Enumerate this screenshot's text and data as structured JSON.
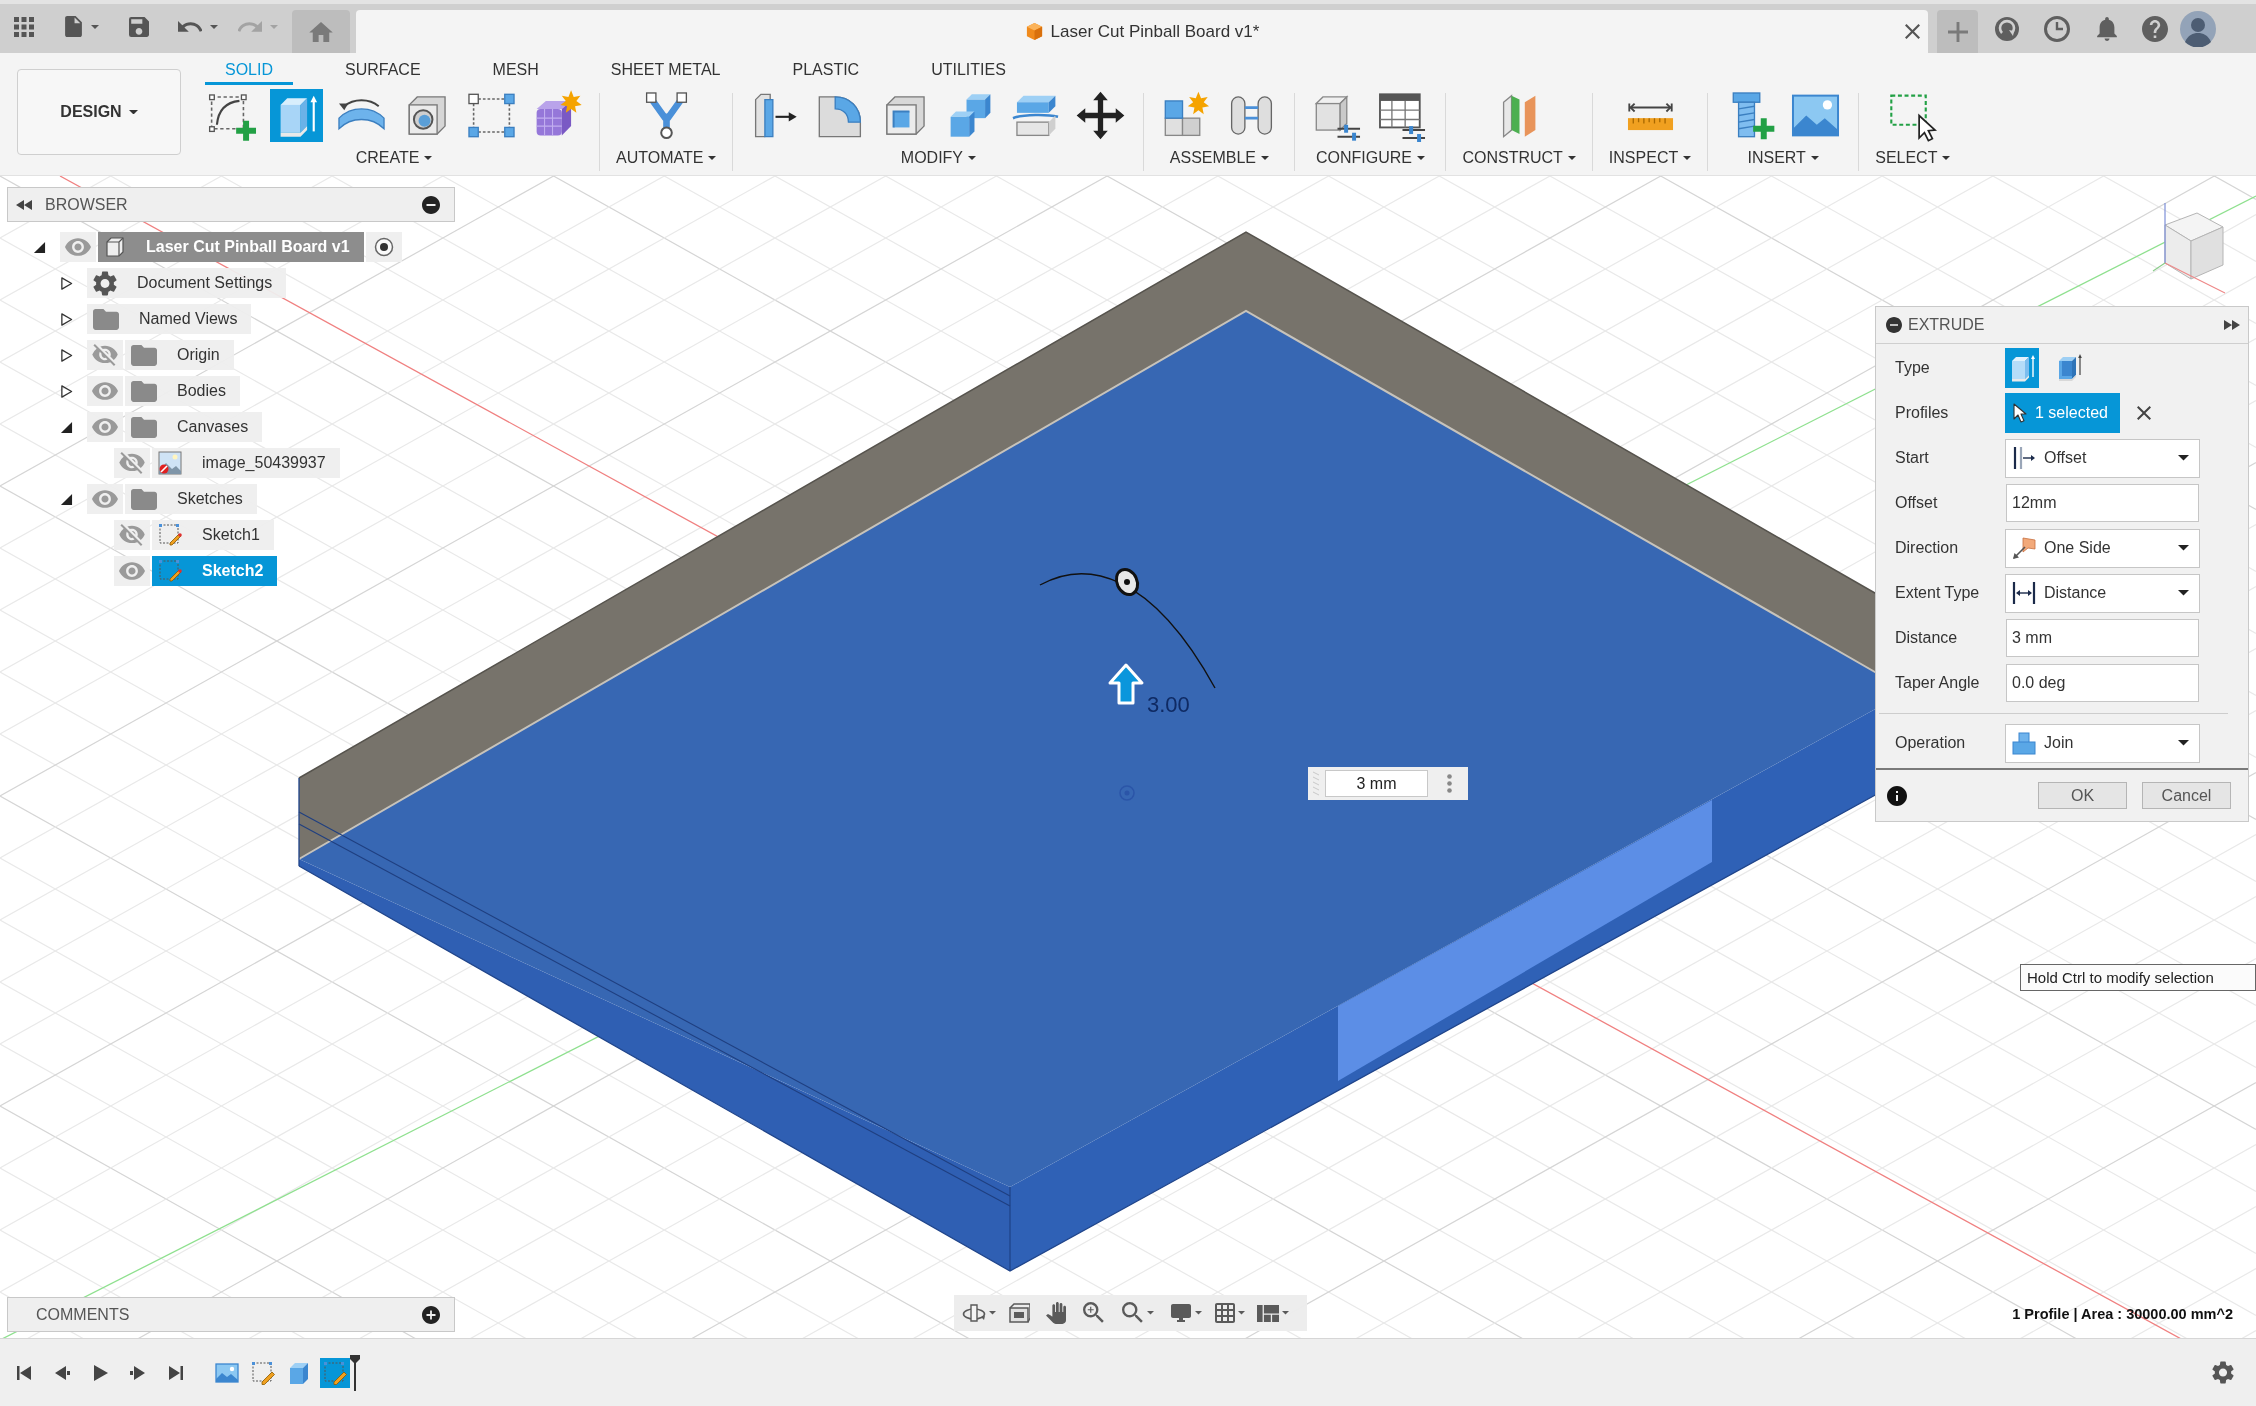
{
  "title_bar": {
    "document_title": "Laser Cut Pinball Board v1*"
  },
  "toolbar": {
    "workspace": "DESIGN",
    "tabs": [
      {
        "label": "SOLID",
        "selected": true
      },
      {
        "label": "SURFACE",
        "selected": false
      },
      {
        "label": "MESH",
        "selected": false
      },
      {
        "label": "SHEET METAL",
        "selected": false
      },
      {
        "label": "PLASTIC",
        "selected": false
      },
      {
        "label": "UTILITIES",
        "selected": false
      }
    ],
    "groups": [
      {
        "label": "CREATE",
        "tools": [
          {
            "kind": "sketch",
            "selected": false
          },
          {
            "kind": "extrude",
            "selected": true
          },
          {
            "kind": "revolve",
            "selected": false
          },
          {
            "kind": "hole",
            "selected": false
          },
          {
            "kind": "pattern",
            "selected": false
          },
          {
            "kind": "form",
            "selected": false
          }
        ]
      },
      {
        "label": "AUTOMATE",
        "tools": [
          {
            "kind": "automate",
            "selected": false
          }
        ]
      },
      {
        "label": "MODIFY",
        "tools": [
          {
            "kind": "presspull",
            "selected": false
          },
          {
            "kind": "fillet",
            "selected": false
          },
          {
            "kind": "shell",
            "selected": false
          },
          {
            "kind": "combine",
            "selected": false
          },
          {
            "kind": "split",
            "selected": false
          },
          {
            "kind": "move",
            "selected": false
          }
        ]
      },
      {
        "label": "ASSEMBLE",
        "tools": [
          {
            "kind": "component",
            "selected": false
          },
          {
            "kind": "joint",
            "selected": false
          }
        ]
      },
      {
        "label": "CONFIGURE",
        "tools": [
          {
            "kind": "parameters",
            "selected": false
          },
          {
            "kind": "table",
            "selected": false
          }
        ]
      },
      {
        "label": "CONSTRUCT",
        "tools": [
          {
            "kind": "plane",
            "selected": false
          }
        ]
      },
      {
        "label": "INSPECT",
        "tools": [
          {
            "kind": "measure",
            "selected": false
          }
        ]
      },
      {
        "label": "INSERT",
        "tools": [
          {
            "kind": "fastener",
            "selected": false
          },
          {
            "kind": "image",
            "selected": false
          }
        ]
      },
      {
        "label": "SELECT",
        "tools": [
          {
            "kind": "select",
            "selected": false
          }
        ]
      }
    ]
  },
  "browser": {
    "title": "BROWSER",
    "tree": [
      {
        "label": "Laser Cut Pinball Board v1",
        "kind": "component",
        "expanded": true,
        "visible": true,
        "active": true,
        "selected": false,
        "children": [
          {
            "label": "Document Settings",
            "kind": "settings",
            "expanded": false,
            "selected": false
          },
          {
            "label": "Named Views",
            "kind": "folder",
            "expanded": false,
            "selected": false
          },
          {
            "label": "Origin",
            "kind": "folder",
            "expanded": false,
            "visible": false,
            "selected": false
          },
          {
            "label": "Bodies",
            "kind": "folder",
            "expanded": false,
            "visible": true,
            "selected": false
          },
          {
            "label": "Canvases",
            "kind": "folder",
            "expanded": true,
            "visible": true,
            "selected": false,
            "children": [
              {
                "label": "image_50439937",
                "kind": "canvas",
                "visible": false,
                "selected": false
              }
            ]
          },
          {
            "label": "Sketches",
            "kind": "folder",
            "expanded": true,
            "visible": true,
            "selected": false,
            "children": [
              {
                "label": "Sketch1",
                "kind": "sketch",
                "visible": false,
                "selected": false
              },
              {
                "label": "Sketch2",
                "kind": "sketch",
                "visible": true,
                "selected": true
              }
            ]
          }
        ]
      }
    ]
  },
  "viewport": {
    "dimension_label": "3.00",
    "distance_input": "3 mm",
    "tooltip": "Hold Ctrl to modify selection",
    "status": "1 Profile | Area : 30000.00 mm^2"
  },
  "extrude_dialog": {
    "title": "EXTRUDE",
    "rows": [
      {
        "kind": "type",
        "label": "Type",
        "options": [
          {
            "kind": "solid",
            "selected": true
          },
          {
            "kind": "thin",
            "selected": false
          }
        ]
      },
      {
        "kind": "selection",
        "label": "Profiles",
        "value": "1 selected"
      },
      {
        "kind": "start",
        "label": "Start",
        "value": "Offset"
      },
      {
        "kind": "input",
        "label": "Offset",
        "value": "12mm"
      },
      {
        "kind": "direction",
        "label": "Direction",
        "value": "One Side"
      },
      {
        "kind": "extent",
        "label": "Extent Type",
        "value": "Distance"
      },
      {
        "kind": "input",
        "label": "Distance",
        "value": "3 mm"
      },
      {
        "kind": "input",
        "label": "Taper Angle",
        "value": "0.0 deg"
      },
      {
        "kind": "operation",
        "label": "Operation",
        "value": "Join"
      }
    ],
    "buttons": [
      "OK",
      "Cancel"
    ]
  },
  "comments": {
    "title": "COMMENTS"
  },
  "timeline": {
    "features": [
      {
        "kind": "canvas",
        "selected": false
      },
      {
        "kind": "sketch",
        "selected": false
      },
      {
        "kind": "extrude",
        "selected": false
      },
      {
        "kind": "sketch",
        "selected": true
      }
    ]
  }
}
